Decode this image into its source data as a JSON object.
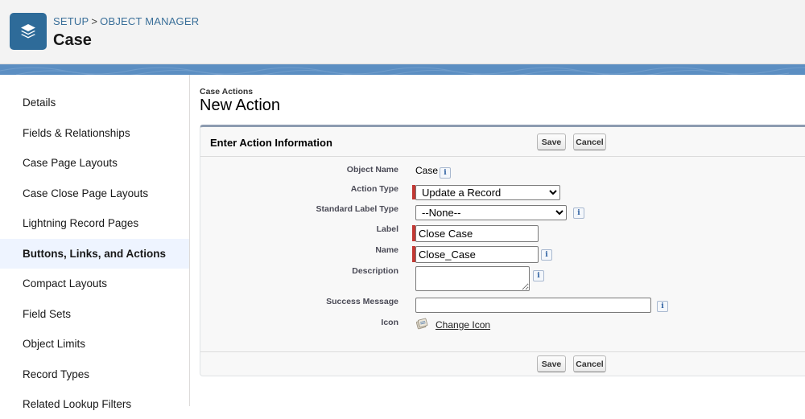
{
  "header": {
    "breadcrumb": {
      "setup": "SETUP",
      "separator": ">",
      "object_manager": "OBJECT MANAGER"
    },
    "object_title": "Case",
    "app_icon": "stack-layers-icon",
    "brand_color": "#2e6b99"
  },
  "sidebar": {
    "items": [
      {
        "label": "Details"
      },
      {
        "label": "Fields & Relationships"
      },
      {
        "label": "Case Page Layouts"
      },
      {
        "label": "Case Close Page Layouts"
      },
      {
        "label": "Lightning Record Pages"
      },
      {
        "label": "Buttons, Links, and Actions",
        "active": true
      },
      {
        "label": "Compact Layouts"
      },
      {
        "label": "Field Sets"
      },
      {
        "label": "Object Limits"
      },
      {
        "label": "Record Types"
      },
      {
        "label": "Related Lookup Filters"
      }
    ]
  },
  "page": {
    "subtitle": "Case Actions",
    "title": "New Action"
  },
  "panel": {
    "title": "Enter Action Information",
    "save_label": "Save",
    "cancel_label": "Cancel"
  },
  "form": {
    "object_name": {
      "label": "Object Name",
      "value": "Case"
    },
    "action_type": {
      "label": "Action Type",
      "value": "Update a Record",
      "required": true
    },
    "standard_label_type": {
      "label": "Standard Label Type",
      "value": "--None--"
    },
    "label_field": {
      "label": "Label",
      "value": "Close Case",
      "required": true
    },
    "name_field": {
      "label": "Name",
      "value": "Close_Case",
      "required": true
    },
    "description": {
      "label": "Description",
      "value": ""
    },
    "success_message": {
      "label": "Success Message",
      "value": ""
    },
    "icon": {
      "label": "Icon",
      "link": "Change Icon",
      "icon_name": "action-icon"
    }
  },
  "colors": {
    "required_bar": "#c23934",
    "active_nav_bg": "#eef4ff",
    "breadcrumb": "#3a6f99"
  }
}
